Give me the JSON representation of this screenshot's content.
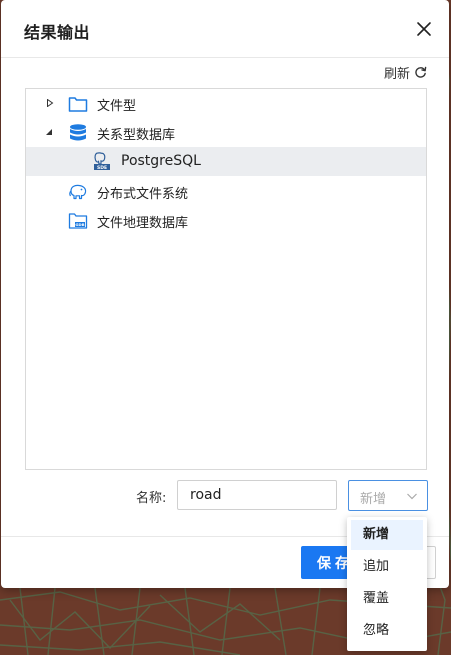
{
  "dialog": {
    "title": "结果输出",
    "refresh_label": "刷新"
  },
  "tree": {
    "items": [
      {
        "label": "文件型",
        "icon": "folder-icon"
      },
      {
        "label": "关系型数据库",
        "icon": "database-icon"
      },
      {
        "label": "PostgreSQL",
        "icon": "postgresql-sde-icon"
      },
      {
        "label": "分布式文件系统",
        "icon": "hdfs-elephant-icon"
      },
      {
        "label": "文件地理数据库",
        "icon": "gdb-folder-icon"
      }
    ],
    "selected": "PostgreSQL"
  },
  "form": {
    "name_label": "名称:",
    "name_value": "road",
    "mode_value": "新增"
  },
  "mode_options": [
    "新增",
    "追加",
    "覆盖",
    "忽略"
  ],
  "footer": {
    "save_label": "保存"
  },
  "colors": {
    "primary": "#1a78f2",
    "icon_blue": "#1e7be0",
    "selected_row": "#ebedf0",
    "dropdown_active": "#eaf3ff",
    "map_bg": "#6b3a2a"
  }
}
